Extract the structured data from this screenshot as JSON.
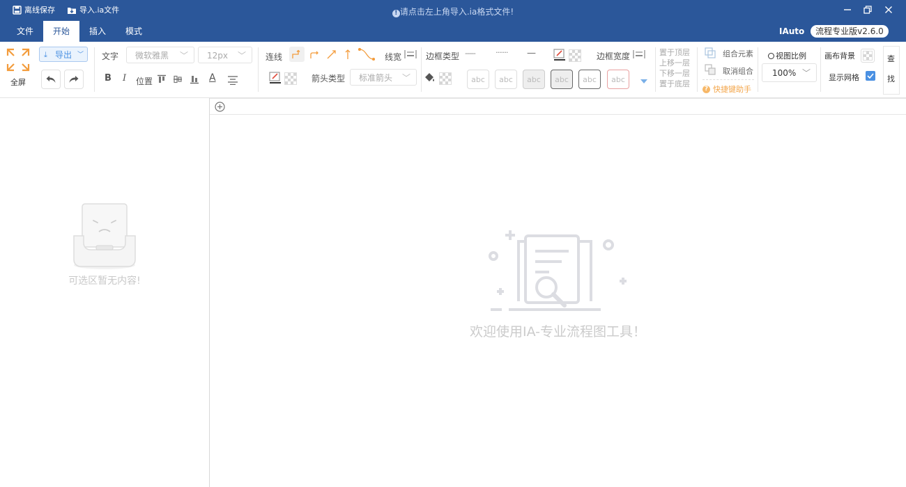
{
  "titlebar": {
    "save_offline": "离线保存",
    "import_ia": "导入.ia文件",
    "hint": "请点击左上角导入.ia格式文件!"
  },
  "menu": {
    "tabs": [
      {
        "label": "文件"
      },
      {
        "label": "开始"
      },
      {
        "label": "插入"
      },
      {
        "label": "模式"
      }
    ],
    "active_tab": "开始",
    "user": "IAuto",
    "version": "流程专业版v2.6.0"
  },
  "ribbon": {
    "fullscreen": "全屏",
    "export": "导出",
    "text_label": "文字",
    "font_family": "微软雅黑",
    "font_size": "12px",
    "bold": "B",
    "italic": "I",
    "position": "位置",
    "text_color_glyph": "A",
    "connector_label": "连线",
    "line_width_label": "线宽",
    "arrow_type_label": "箭头类型",
    "arrow_type_value": "标准箭头",
    "border_type_label": "边框类型",
    "border_width_label": "边框宽度",
    "border_dash": "-----",
    "border_dot": "·······",
    "border_solid": "—",
    "style_preset": "abc",
    "layers": {
      "to_top": "置于顶层",
      "up_one": "上移一层",
      "down_one": "下移一层",
      "to_bottom": "置于底层"
    },
    "group": "组合元素",
    "ungroup": "取消组合",
    "shortcut_help": "快捷键助手",
    "view_ratio_label": "视图比例",
    "view_ratio_value": "100%",
    "canvas_bg": "画布背景",
    "show_grid": "显示网格",
    "show_grid_checked": true,
    "search_1": "查",
    "search_2": "找"
  },
  "left_panel": {
    "empty_text": "可选区暂无内容!"
  },
  "canvas": {
    "welcome": "欢迎使用IA-专业流程图工具！"
  },
  "colors": {
    "titlebar_bg": "#2b579a",
    "accent_orange": "#f39c3c",
    "accent_blue": "#4a90e2"
  }
}
